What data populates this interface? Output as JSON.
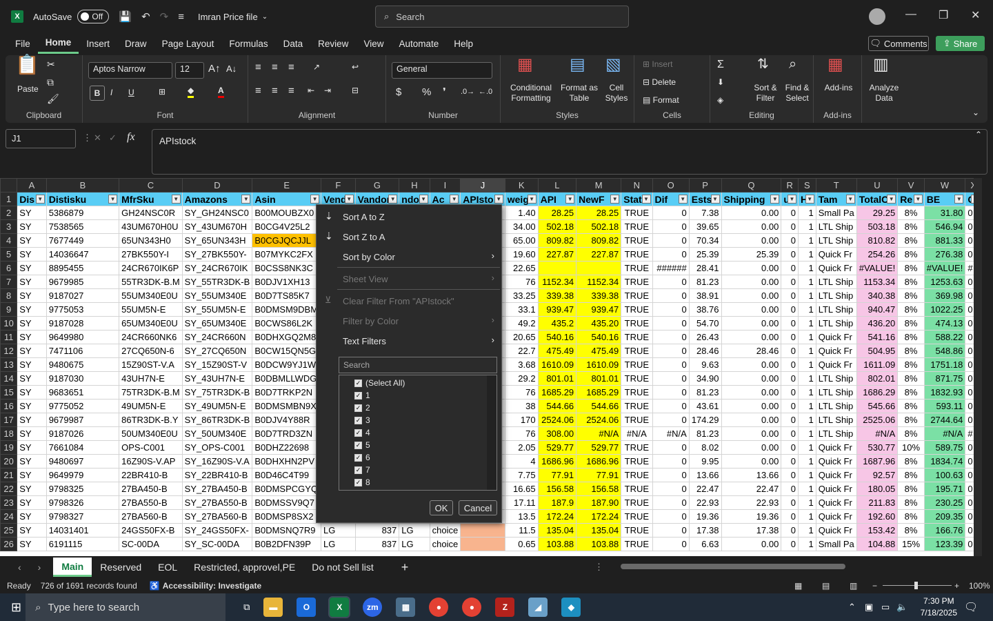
{
  "titlebar": {
    "autosave_label": "AutoSave",
    "autosave_state": "Off",
    "filename": "Imran Price file",
    "search_placeholder": "Search"
  },
  "menu": [
    "File",
    "Home",
    "Insert",
    "Draw",
    "Page Layout",
    "Formulas",
    "Data",
    "Review",
    "View",
    "Automate",
    "Help"
  ],
  "menu_active": "Home",
  "comments_label": "Comments",
  "share_label": "Share",
  "ribbon": {
    "paste": "Paste",
    "clipboard": "Clipboard",
    "font_name": "Aptos Narrow",
    "font_size": "12",
    "font": "Font",
    "alignment": "Alignment",
    "number_format": "General",
    "number": "Number",
    "conditional": "Conditional Formatting",
    "format_table": "Format as Table",
    "cell_styles": "Cell Styles",
    "styles": "Styles",
    "insert": "Insert",
    "delete": "Delete",
    "format": "Format",
    "cells": "Cells",
    "sort_filter": "Sort & Filter",
    "find_select": "Find & Select",
    "editing": "Editing",
    "addins": "Add-ins",
    "addins_group": "Add-ins",
    "analyze": "Analyze Data"
  },
  "namebox": "J1",
  "formula": "APIstock",
  "columns": [
    "A",
    "B",
    "C",
    "D",
    "E",
    "F",
    "G",
    "H",
    "I",
    "J",
    "K",
    "L",
    "M",
    "N",
    "O",
    "P",
    "Q",
    "R",
    "S",
    "T",
    "U",
    "V",
    "W",
    "X"
  ],
  "headers": [
    "Dis",
    "Distisku",
    "MfrSku",
    "Amazons",
    "Asin",
    "Vend",
    "Vandor",
    "ndor",
    "Ac",
    "APIsto",
    "weig",
    "API",
    "NewF",
    "Stat",
    "Dif",
    "Ests",
    "Shipping",
    "ui",
    "H",
    "Tam",
    "TotalC",
    "Re",
    "BE",
    "Gl"
  ],
  "rows": [
    {
      "n": "2",
      "c": [
        "SY",
        "5386879",
        "GH24NSC0R",
        "SY_GH24NSC0",
        "B00MOUBZX0",
        "",
        "",
        "",
        "",
        "",
        "1.40",
        "28.25",
        "28.25",
        "TRUE",
        "0",
        "7.38",
        "0.00",
        "0",
        "1",
        "Small Pa",
        "29.25",
        "8%",
        "31.80",
        "0"
      ]
    },
    {
      "n": "3",
      "c": [
        "SY",
        "7538565",
        "43UM670H0U",
        "SY_43UM670H",
        "B0CG4V25L2",
        "",
        "",
        "",
        "",
        "",
        "34.00",
        "502.18",
        "502.18",
        "TRUE",
        "0",
        "39.65",
        "0.00",
        "0",
        "1",
        "LTL Ship",
        "503.18",
        "8%",
        "546.94",
        "0"
      ]
    },
    {
      "n": "4",
      "c": [
        "SY",
        "7677449",
        "65UN343H0",
        "SY_65UN343H",
        "B0CGJQCJJL",
        "",
        "",
        "",
        "",
        "",
        "65.00",
        "809.82",
        "809.82",
        "TRUE",
        "0",
        "70.34",
        "0.00",
        "0",
        "1",
        "LTL Ship",
        "810.82",
        "8%",
        "881.33",
        "0"
      ]
    },
    {
      "n": "5",
      "c": [
        "SY",
        "14036647",
        "27BK550Y-I",
        "SY_27BK550Y-",
        "B07MYKC2FX",
        "",
        "",
        "",
        "",
        "",
        "19.60",
        "227.87",
        "227.87",
        "TRUE",
        "0",
        "25.39",
        "25.39",
        "0",
        "1",
        "Quick Fr",
        "254.26",
        "8%",
        "276.38",
        "0"
      ]
    },
    {
      "n": "6",
      "c": [
        "SY",
        "8895455",
        "24CR670IK6P",
        "SY_24CR670IK",
        "B0CSS8NK3C",
        "",
        "",
        "",
        "",
        "",
        "22.65",
        "",
        "",
        "TRUE",
        "######",
        "28.41",
        "0.00",
        "0",
        "1",
        "Quick Fr",
        "#VALUE!",
        "8%",
        "#VALUE!",
        "#"
      ]
    },
    {
      "n": "7",
      "c": [
        "SY",
        "9679985",
        "55TR3DK-B.M",
        "SY_55TR3DK-B",
        "B0DJV1XH13",
        "",
        "",
        "",
        "",
        "",
        "76",
        "1152.34",
        "1152.34",
        "TRUE",
        "0",
        "81.23",
        "0.00",
        "0",
        "1",
        "LTL Ship",
        "1153.34",
        "8%",
        "1253.63",
        "0"
      ]
    },
    {
      "n": "8",
      "c": [
        "SY",
        "9187027",
        "55UM340E0U",
        "SY_55UM340E",
        "B0D7TS85K7",
        "",
        "",
        "",
        "",
        "",
        "33.25",
        "339.38",
        "339.38",
        "TRUE",
        "0",
        "38.91",
        "0.00",
        "0",
        "1",
        "LTL Ship",
        "340.38",
        "8%",
        "369.98",
        "0"
      ]
    },
    {
      "n": "9",
      "c": [
        "SY",
        "9775053",
        "55UM5N-E",
        "SY_55UM5N-E",
        "B0DMSM9DBM",
        "",
        "",
        "",
        "",
        "",
        "33.1",
        "939.47",
        "939.47",
        "TRUE",
        "0",
        "38.76",
        "0.00",
        "0",
        "1",
        "LTL Ship",
        "940.47",
        "8%",
        "1022.25",
        "0"
      ]
    },
    {
      "n": "10",
      "c": [
        "SY",
        "9187028",
        "65UM340E0U",
        "SY_65UM340E",
        "B0CWS86L2K",
        "",
        "",
        "",
        "",
        "",
        "49.2",
        "435.2",
        "435.20",
        "TRUE",
        "0",
        "54.70",
        "0.00",
        "0",
        "1",
        "LTL Ship",
        "436.20",
        "8%",
        "474.13",
        "0"
      ]
    },
    {
      "n": "11",
      "c": [
        "SY",
        "9649980",
        "24CR660NK6",
        "SY_24CR660N",
        "B0DHXGQ2M8",
        "",
        "",
        "",
        "",
        "",
        "20.65",
        "540.16",
        "540.16",
        "TRUE",
        "0",
        "26.43",
        "0.00",
        "0",
        "1",
        "Quick Fr",
        "541.16",
        "8%",
        "588.22",
        "0"
      ]
    },
    {
      "n": "12",
      "c": [
        "SY",
        "7471106",
        "27CQ650N-6",
        "SY_27CQ650N",
        "B0CW15QN5G",
        "",
        "",
        "",
        "",
        "",
        "22.7",
        "475.49",
        "475.49",
        "TRUE",
        "0",
        "28.46",
        "28.46",
        "0",
        "1",
        "Quick Fr",
        "504.95",
        "8%",
        "548.86",
        "0"
      ]
    },
    {
      "n": "13",
      "c": [
        "SY",
        "9480675",
        "15Z90ST-V.A",
        "SY_15Z90ST-V",
        "B0DCW9YJ1W",
        "",
        "",
        "",
        "",
        "",
        "3.68",
        "1610.09",
        "1610.09",
        "TRUE",
        "0",
        "9.63",
        "0.00",
        "0",
        "1",
        "Quick Fr",
        "1611.09",
        "8%",
        "1751.18",
        "0"
      ]
    },
    {
      "n": "14",
      "c": [
        "SY",
        "9187030",
        "43UH7N-E",
        "SY_43UH7N-E",
        "B0DBMLLWDG",
        "",
        "",
        "",
        "",
        "",
        "29.2",
        "801.01",
        "801.01",
        "TRUE",
        "0",
        "34.90",
        "0.00",
        "0",
        "1",
        "LTL Ship",
        "802.01",
        "8%",
        "871.75",
        "0"
      ]
    },
    {
      "n": "15",
      "c": [
        "SY",
        "9683651",
        "75TR3DK-B.M",
        "SY_75TR3DK-B",
        "B0D7TRKP2N",
        "",
        "",
        "",
        "",
        "",
        "76",
        "1685.29",
        "1685.29",
        "TRUE",
        "0",
        "81.23",
        "0.00",
        "0",
        "1",
        "LTL Ship",
        "1686.29",
        "8%",
        "1832.93",
        "0"
      ]
    },
    {
      "n": "16",
      "c": [
        "SY",
        "9775052",
        "49UM5N-E",
        "SY_49UM5N-E",
        "B0DMSMBN9X",
        "",
        "",
        "",
        "",
        "",
        "38",
        "544.66",
        "544.66",
        "TRUE",
        "0",
        "43.61",
        "0.00",
        "0",
        "1",
        "LTL Ship",
        "545.66",
        "8%",
        "593.11",
        "0"
      ]
    },
    {
      "n": "17",
      "c": [
        "SY",
        "9679987",
        "86TR3DK-B.Y",
        "SY_86TR3DK-B",
        "B0DJV4Y88R",
        "",
        "",
        "",
        "",
        "",
        "170",
        "2524.06",
        "2524.06",
        "TRUE",
        "0",
        "174.29",
        "0.00",
        "0",
        "1",
        "LTL Ship",
        "2525.06",
        "8%",
        "2744.64",
        "0"
      ]
    },
    {
      "n": "18",
      "c": [
        "SY",
        "9187026",
        "50UM340E0U",
        "SY_50UM340E",
        "B0D7TRD3ZN",
        "",
        "",
        "",
        "",
        "",
        "76",
        "308.00",
        "#N/A",
        "#N/A",
        "#N/A",
        "81.23",
        "0.00",
        "0",
        "1",
        "LTL Ship",
        "#N/A",
        "8%",
        "#N/A",
        "#"
      ]
    },
    {
      "n": "19",
      "c": [
        "SY",
        "7661084",
        "OPS-C001",
        "SY_OPS-C001",
        "B0DHZ22698",
        "",
        "",
        "",
        "",
        "",
        "2.05",
        "529.77",
        "529.77",
        "TRUE",
        "0",
        "8.02",
        "0.00",
        "0",
        "1",
        "Quick Fr",
        "530.77",
        "10%",
        "589.75",
        "0"
      ]
    },
    {
      "n": "20",
      "c": [
        "SY",
        "9480697",
        "16Z90S-V.AP",
        "SY_16Z90S-V.A",
        "B0DHXHN2PV",
        "",
        "",
        "",
        "",
        "",
        "4",
        "1686.96",
        "1686.96",
        "TRUE",
        "0",
        "9.95",
        "0.00",
        "0",
        "1",
        "Quick Fr",
        "1687.96",
        "8%",
        "1834.74",
        "0"
      ]
    },
    {
      "n": "21",
      "c": [
        "SY",
        "9649979",
        "22BR410-B",
        "SY_22BR410-B",
        "B0D46C4T99",
        "",
        "",
        "",
        "",
        "",
        "7.75",
        "77.91",
        "77.91",
        "TRUE",
        "0",
        "13.66",
        "13.66",
        "0",
        "1",
        "Quick Fr",
        "92.57",
        "8%",
        "100.63",
        "0"
      ]
    },
    {
      "n": "22",
      "c": [
        "SY",
        "9798325",
        "27BA450-B",
        "SY_27BA450-B",
        "B0DMSPCGYQ",
        "",
        "",
        "",
        "",
        "",
        "16.65",
        "156.58",
        "156.58",
        "TRUE",
        "0",
        "22.47",
        "22.47",
        "0",
        "1",
        "Quick Fr",
        "180.05",
        "8%",
        "195.71",
        "0"
      ]
    },
    {
      "n": "23",
      "c": [
        "SY",
        "9798326",
        "27BA550-B",
        "SY_27BA550-B",
        "B0DMSSV9Q7",
        "",
        "",
        "",
        "",
        "",
        "17.11",
        "187.9",
        "187.90",
        "TRUE",
        "0",
        "22.93",
        "22.93",
        "0",
        "1",
        "Quick Fr",
        "211.83",
        "8%",
        "230.25",
        "0"
      ]
    },
    {
      "n": "24",
      "c": [
        "SY",
        "9798327",
        "27BA560-B",
        "SY_27BA560-B",
        "B0DMSP8SX2",
        "",
        "",
        "",
        "",
        "",
        "13.5",
        "172.24",
        "172.24",
        "TRUE",
        "0",
        "19.36",
        "19.36",
        "0",
        "1",
        "Quick Fr",
        "192.60",
        "8%",
        "209.35",
        "0"
      ]
    },
    {
      "n": "25",
      "c": [
        "SY",
        "14031401",
        "24GS50FX-B",
        "SY_24GS50FX-",
        "B0DMSNQ7R9",
        "LG",
        "837",
        "LG",
        "choice",
        "",
        "11.5",
        "135.04",
        "135.04",
        "TRUE",
        "0",
        "17.38",
        "17.38",
        "0",
        "1",
        "Quick Fr",
        "153.42",
        "8%",
        "166.76",
        "0"
      ]
    },
    {
      "n": "26",
      "c": [
        "SY",
        "6191115",
        "SC-00DA",
        "SY_SC-00DA",
        "B0B2DFN39P",
        "LG",
        "837",
        "LG",
        "choice",
        "",
        "0.65",
        "103.88",
        "103.88",
        "TRUE",
        "0",
        "6.63",
        "0.00",
        "0",
        "1",
        "Small Pa",
        "104.88",
        "15%",
        "123.39",
        "0"
      ]
    }
  ],
  "filter_menu": {
    "sort_az": "Sort A to Z",
    "sort_za": "Sort Z to A",
    "sort_color": "Sort by Color",
    "sheet_view": "Sheet View",
    "clear_filter": "Clear Filter From \"APIstock\"",
    "filter_color": "Filter by Color",
    "text_filters": "Text Filters",
    "search_placeholder": "Search",
    "items": [
      "(Select All)",
      "1",
      "2",
      "3",
      "4",
      "5",
      "6",
      "7",
      "8"
    ],
    "ok": "OK",
    "cancel": "Cancel"
  },
  "tabs": [
    "Main",
    "Reserved",
    "EOL",
    "Restricted, approvel,PE",
    "Do not Sell list"
  ],
  "active_tab": "Main",
  "status": {
    "ready": "Ready",
    "records": "726 of 1691 records found",
    "accessibility": "Accessibility: Investigate",
    "zoom": "100%"
  },
  "taskbar": {
    "search_placeholder": "Type here to search",
    "time": "7:30 PM",
    "date": "7/18/2025"
  }
}
